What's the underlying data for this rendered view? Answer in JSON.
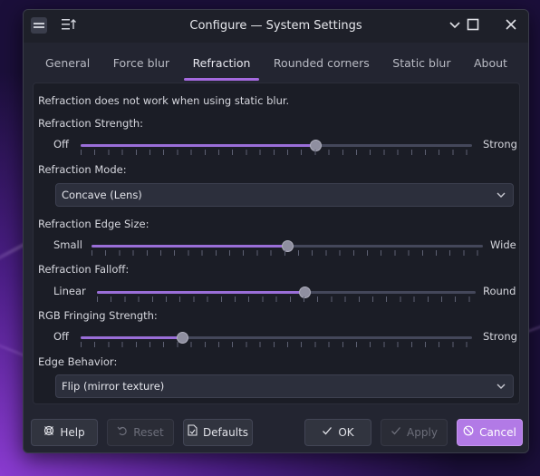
{
  "window": {
    "title": "Configure — System Settings"
  },
  "tabs": [
    {
      "label": "General"
    },
    {
      "label": "Force blur"
    },
    {
      "label": "Refraction"
    },
    {
      "label": "Rounded corners"
    },
    {
      "label": "Static blur"
    },
    {
      "label": "About"
    }
  ],
  "active_tab": "Refraction",
  "notice": "Refraction does not work when using static blur.",
  "refraction_strength": {
    "label": "Refraction Strength:",
    "min_label": "Off",
    "max_label": "Strong",
    "value_fraction": 0.6
  },
  "refraction_mode": {
    "label": "Refraction Mode:",
    "value": "Concave (Lens)"
  },
  "edge_size": {
    "label": "Refraction Edge Size:",
    "min_label": "Small",
    "max_label": "Wide",
    "value_fraction": 0.5
  },
  "falloff": {
    "label": "Refraction Falloff:",
    "min_label": "Linear",
    "max_label": "Round",
    "value_fraction": 0.55
  },
  "rgb_fringing": {
    "label": "RGB Fringing Strength:",
    "min_label": "Off",
    "max_label": "Strong",
    "value_fraction": 0.26
  },
  "edge_behavior": {
    "label": "Edge Behavior:",
    "value": "Flip (mirror texture)"
  },
  "footer": {
    "help": "Help",
    "reset": "Reset",
    "defaults": "Defaults",
    "ok": "OK",
    "apply": "Apply",
    "cancel": "Cancel"
  },
  "colors": {
    "accent": "#b27ae6",
    "slider_fill": "#9a6ed8",
    "window_bg": "#232531"
  },
  "icons": {
    "app": "app-icon",
    "menu": "hamburger-menu-icon",
    "minimize": "minimize-icon",
    "maximize": "maximize-icon",
    "close": "close-icon",
    "help": "help-icon",
    "reset": "undo-icon",
    "defaults": "document-icon",
    "ok": "checkmark-icon",
    "apply": "checkmark-icon",
    "cancel": "cancel-icon",
    "combo": "chevron-down-icon"
  }
}
